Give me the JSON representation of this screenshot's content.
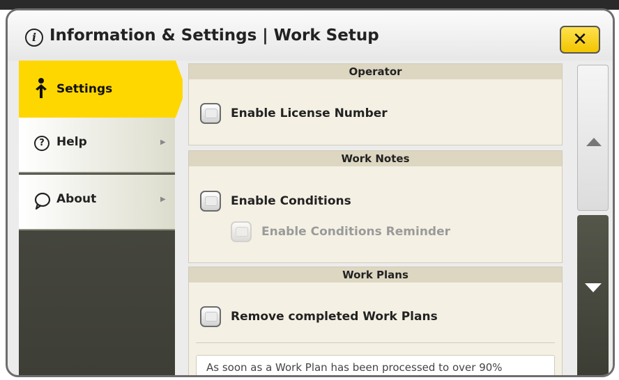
{
  "header": {
    "title": "Information & Settings | Work Setup",
    "info_icon": "i",
    "close_label": "✕"
  },
  "sidebar": {
    "items": [
      {
        "label": "Settings",
        "icon": "person-icon",
        "active": true
      },
      {
        "label": "Help",
        "icon": "question-icon",
        "active": false
      },
      {
        "label": "About",
        "icon": "speech-bubble-icon",
        "active": false
      }
    ]
  },
  "sections": [
    {
      "title": "Operator",
      "rows": [
        {
          "label": "Enable License Number",
          "enabled": true
        }
      ]
    },
    {
      "title": "Work Notes",
      "rows": [
        {
          "label": "Enable Conditions",
          "enabled": true
        },
        {
          "label": "Enable Conditions Reminder",
          "enabled": false
        }
      ]
    },
    {
      "title": "Work Plans",
      "rows": [
        {
          "label": "Remove completed Work Plans",
          "enabled": true
        }
      ],
      "description": "As soon as a Work Plan has been processed to over 90%"
    }
  ],
  "colors": {
    "accent": "#ffd700",
    "sidebar_dark": "#4a4b42",
    "section_head": "#ddd7c2"
  }
}
